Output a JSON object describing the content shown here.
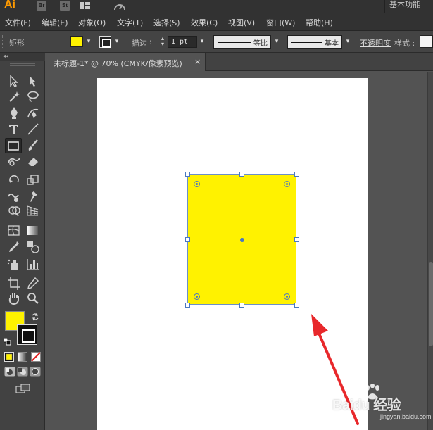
{
  "app": {
    "logo": "Ai",
    "bridge_label": "Br",
    "stock_label": "St",
    "workspace": "基本功能"
  },
  "menu": [
    "文件(F)",
    "编辑(E)",
    "对象(O)",
    "文字(T)",
    "选择(S)",
    "效果(C)",
    "视图(V)",
    "窗口(W)",
    "帮助(H)"
  ],
  "control": {
    "object_type": "矩形",
    "fill_color": "#fff200",
    "stroke_label": "描边",
    "stroke_colon": ":",
    "stroke_weight": "1 pt",
    "profile_1": "等比",
    "profile_2": "基本",
    "opacity_label": "不透明度",
    "style_label": "样式 :"
  },
  "document": {
    "tab_title": "未标题-1* @ 70% (CMYK/像素预览)",
    "close_glyph": "×"
  },
  "toolbar": {
    "collapse_glyph": "◂◂",
    "tools": [
      "selection",
      "direct-selection",
      "magic-wand",
      "lasso",
      "pen",
      "curvature",
      "type",
      "line-segment",
      "rectangle",
      "paintbrush",
      "shaper",
      "eraser",
      "rotate",
      "scale",
      "warp",
      "puppet-warp",
      "shape-builder",
      "perspective-grid",
      "mesh",
      "gradient",
      "eyedropper",
      "blend",
      "symbol-sprayer",
      "column-graph",
      "artboard",
      "slice",
      "hand",
      "zoom"
    ],
    "fill_color": "#fff200",
    "stroke_color": "#000000"
  },
  "artwork": {
    "shape": "rectangle",
    "fill": "#fff200",
    "selection_color": "#4a78c2"
  },
  "annotation": {
    "arrow_color": "#e8282b"
  },
  "watermark": {
    "brand": "Bai",
    "paw": "du",
    "experience": "经验",
    "url": "jingyan.baidu.com"
  }
}
